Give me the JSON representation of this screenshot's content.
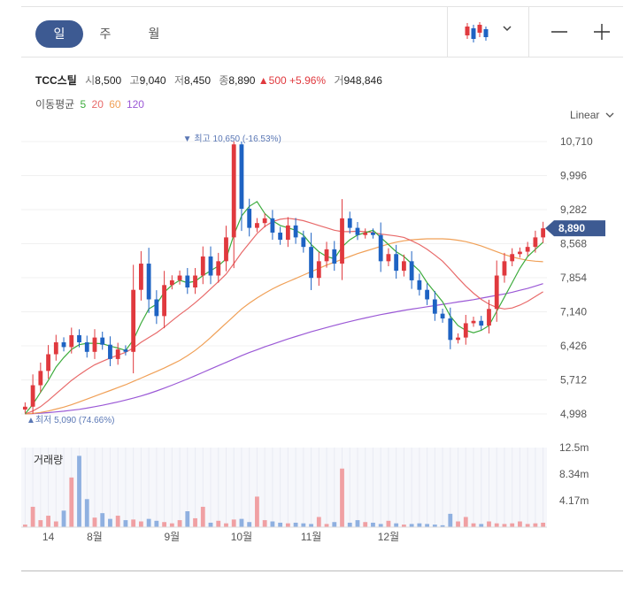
{
  "tabs": [
    {
      "label": "일",
      "active": true
    },
    {
      "label": "주",
      "active": false
    },
    {
      "label": "월",
      "active": false
    }
  ],
  "toolbar": {
    "chart_type_icon": "candlestick-icon",
    "dropdown_icon": "chevron-down-icon",
    "zoom_out_icon": "minus-icon",
    "zoom_in_icon": "plus-icon"
  },
  "stock": {
    "name": "TCC스틸",
    "open_label": "시",
    "open": "8,500",
    "high_label": "고",
    "high": "9,040",
    "low_label": "저",
    "low": "8,450",
    "close_label": "종",
    "close": "8,890",
    "change": "500",
    "change_pct": "+5.96%",
    "volume_label": "거",
    "volume": "948,846"
  },
  "ma_legend": {
    "label": "이동평균",
    "items": [
      {
        "period": "5",
        "color": "#3dac3d"
      },
      {
        "period": "20",
        "color": "#e86a6a"
      },
      {
        "period": "60",
        "color": "#f0a057"
      },
      {
        "period": "120",
        "color": "#9b59d6"
      }
    ]
  },
  "scale_label": "Linear",
  "colors": {
    "up": "#e0393e",
    "down": "#1e63c3",
    "badge": "#3d5a92"
  },
  "chart_data": {
    "type": "candlestick",
    "y_ticks": [
      "10,710",
      "9,996",
      "9,282",
      "8,568",
      "7,854",
      "7,140",
      "6,426",
      "5,712",
      "4,998"
    ],
    "ylim": [
      4998,
      10710
    ],
    "current_price": "8,890",
    "high_annotation": "최고 10,650 (-16.53%)",
    "low_annotation": "최저 5,090 (74.66%)",
    "x_labels": [
      "14",
      "8월",
      "9월",
      "10월",
      "11월",
      "12월"
    ],
    "volume_label": "거래량",
    "volume_ticks": [
      "12.5m",
      "8.34m",
      "4.17m"
    ],
    "volume_max": 12.5,
    "close": [
      5150,
      5600,
      5900,
      6250,
      6500,
      6400,
      6650,
      6500,
      6300,
      6600,
      6450,
      6150,
      6350,
      6300,
      7600,
      8150,
      7400,
      7050,
      7700,
      7800,
      7900,
      7650,
      7900,
      8300,
      7900,
      8200,
      8700,
      10650,
      9300,
      8900,
      9000,
      9100,
      8800,
      8650,
      8950,
      8700,
      8500,
      7850,
      8200,
      8450,
      8150,
      9100,
      8900,
      8750,
      8800,
      8750,
      8200,
      8350,
      8000,
      8200,
      7800,
      7600,
      7400,
      7100,
      7000,
      6550,
      6600,
      6900,
      6950,
      6850,
      7200,
      7900,
      8200,
      8350,
      8400,
      8500,
      8700,
      8890
    ],
    "ma5": [
      5000,
      5200,
      5450,
      5700,
      5980,
      6180,
      6350,
      6450,
      6480,
      6480,
      6470,
      6420,
      6380,
      6330,
      6550,
      6900,
      7200,
      7300,
      7550,
      7700,
      7800,
      7750,
      7780,
      7900,
      8000,
      8100,
      8250,
      8750,
      9150,
      9350,
      9450,
      9200,
      9050,
      8950,
      8900,
      8850,
      8750,
      8550,
      8400,
      8300,
      8250,
      8500,
      8650,
      8750,
      8800,
      8850,
      8700,
      8550,
      8400,
      8300,
      8150,
      8000,
      7750,
      7550,
      7350,
      7050,
      6850,
      6750,
      6700,
      6750,
      6850,
      7150,
      7450,
      7750,
      8050,
      8300,
      8450,
      8600
    ],
    "ma20": [
      4998,
      5060,
      5150,
      5280,
      5420,
      5560,
      5700,
      5820,
      5930,
      6030,
      6100,
      6170,
      6230,
      6290,
      6380,
      6500,
      6600,
      6700,
      6820,
      6950,
      7080,
      7200,
      7330,
      7470,
      7620,
      7770,
      7930,
      8150,
      8380,
      8580,
      8780,
      8930,
      9030,
      9080,
      9100,
      9080,
      9050,
      9000,
      8950,
      8900,
      8850,
      8820,
      8820,
      8830,
      8820,
      8800,
      8770,
      8750,
      8730,
      8700,
      8630,
      8550,
      8450,
      8330,
      8200,
      8030,
      7850,
      7680,
      7530,
      7400,
      7300,
      7230,
      7200,
      7220,
      7280,
      7360,
      7460,
      7560
    ],
    "ma60": [
      4998,
      5010,
      5030,
      5060,
      5100,
      5140,
      5190,
      5250,
      5310,
      5370,
      5430,
      5490,
      5550,
      5610,
      5680,
      5750,
      5820,
      5890,
      5960,
      6040,
      6120,
      6220,
      6330,
      6460,
      6600,
      6750,
      6900,
      7050,
      7200,
      7320,
      7430,
      7530,
      7620,
      7700,
      7770,
      7840,
      7910,
      7980,
      8050,
      8120,
      8180,
      8240,
      8300,
      8360,
      8410,
      8460,
      8510,
      8560,
      8600,
      8630,
      8650,
      8660,
      8670,
      8670,
      8670,
      8660,
      8640,
      8610,
      8570,
      8520,
      8460,
      8400,
      8340,
      8290,
      8250,
      8220,
      8200,
      8190
    ],
    "ma120": [
      4998,
      5005,
      5015,
      5025,
      5040,
      5055,
      5075,
      5095,
      5120,
      5150,
      5180,
      5215,
      5250,
      5290,
      5330,
      5375,
      5425,
      5480,
      5540,
      5600,
      5665,
      5730,
      5800,
      5870,
      5940,
      6010,
      6080,
      6150,
      6220,
      6285,
      6345,
      6405,
      6460,
      6515,
      6570,
      6620,
      6670,
      6720,
      6765,
      6810,
      6855,
      6895,
      6935,
      6975,
      7010,
      7045,
      7080,
      7110,
      7140,
      7170,
      7195,
      7220,
      7245,
      7270,
      7295,
      7320,
      7345,
      7370,
      7395,
      7425,
      7455,
      7485,
      7515,
      7550,
      7590,
      7630,
      7680,
      7730
    ],
    "volume": [
      0.4,
      3.2,
      1.1,
      1.8,
      0.9,
      2.6,
      7.8,
      11.2,
      4.4,
      1.5,
      2.2,
      1.3,
      1.8,
      1.1,
      1.2,
      0.9,
      1.3,
      1.0,
      0.8,
      0.6,
      1.1,
      2.5,
      1.4,
      3.2,
      0.7,
      1.0,
      0.6,
      1.2,
      1.3,
      0.8,
      4.8,
      1.1,
      0.9,
      0.7,
      0.6,
      0.7,
      0.6,
      0.5,
      1.6,
      0.5,
      0.8,
      9.2,
      0.7,
      1.1,
      0.8,
      0.7,
      0.5,
      1.0,
      0.6,
      0.4,
      0.5,
      0.6,
      0.5,
      0.4,
      0.3,
      2.1,
      0.9,
      1.6,
      0.6,
      0.5,
      0.9,
      0.6,
      0.5,
      0.6,
      0.9,
      0.5,
      0.6,
      0.7
    ]
  }
}
